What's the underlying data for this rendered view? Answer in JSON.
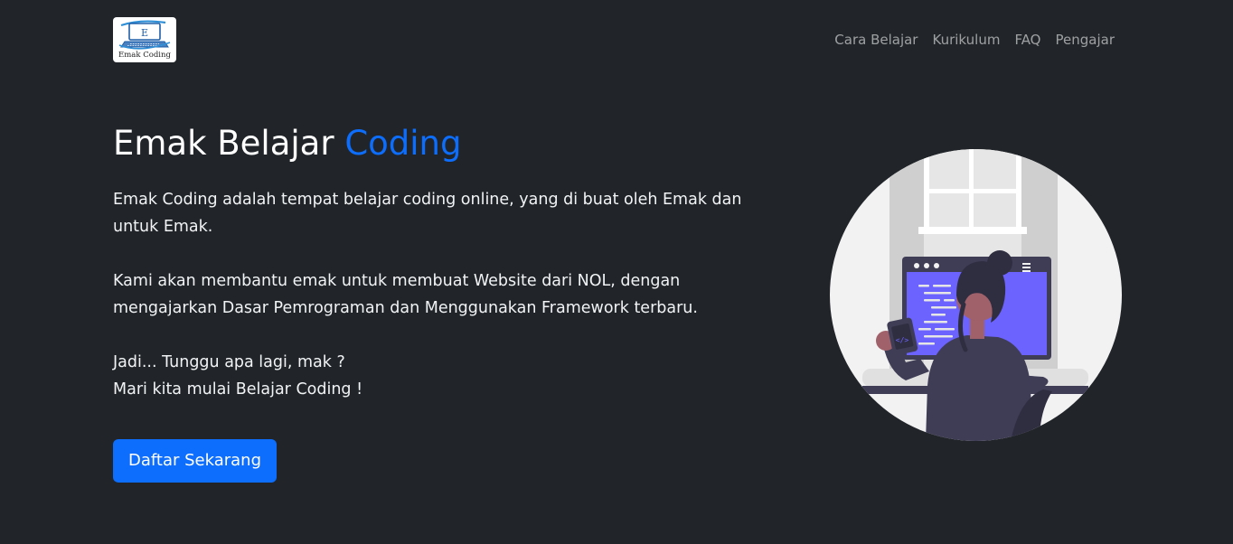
{
  "header": {
    "logo_text": "Emak Coding",
    "nav": [
      {
        "label": "Cara Belajar"
      },
      {
        "label": "Kurikulum"
      },
      {
        "label": "FAQ"
      },
      {
        "label": "Pengajar"
      }
    ]
  },
  "hero": {
    "title_main": "Emak Belajar ",
    "title_highlight": "Coding",
    "paragraph_1": "Emak Coding adalah tempat belajar coding online, yang di buat oleh Emak dan untuk Emak.",
    "paragraph_2": "Kami akan membantu emak untuk membuat Website dari NOL, dengan mengajarkan Dasar Pemrograman dan Menggunakan Framework terbaru.",
    "paragraph_3_line_1": "Jadi... Tunggu apa lagi, mak ?",
    "paragraph_3_line_2": "Mari kita mulai Belajar Coding !",
    "cta_label": "Daftar Sekarang"
  },
  "colors": {
    "background": "#212529",
    "accent": "#0d6efd",
    "nav_link": "rgba(255,255,255,0.56)",
    "screen": "#6c63ff"
  },
  "icons": {
    "logo": "laptop-logo-icon",
    "illustration": "woman-coding-illustration"
  }
}
